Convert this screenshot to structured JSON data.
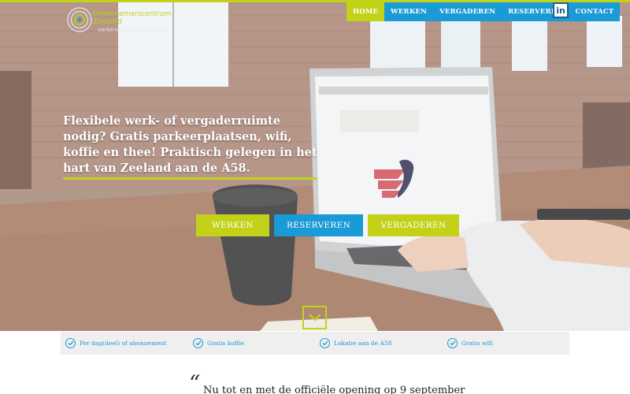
{
  "brand": {
    "name": "Ondernemerscentrum Zeeland",
    "tagline": "verbinden en verbinden",
    "accent": "#c3d219",
    "primary": "#1a9ad6"
  },
  "nav": {
    "items": [
      {
        "label": "HOME",
        "active": true
      },
      {
        "label": "WERKEN",
        "active": false
      },
      {
        "label": "VERGADEREN",
        "active": false
      },
      {
        "label": "RESERVEREN",
        "active": false
      },
      {
        "label": "CONTACT",
        "active": false
      }
    ],
    "social": {
      "icon": "linkedin-icon",
      "label": "in"
    }
  },
  "hero": {
    "headline": "Flexibele werk- of vergaderruimte nodig? Gratis parkeerplaatsen, wifi, koffie en thee! Praktisch gelegen in het hart van Zeeland aan de A58.",
    "buttons": [
      {
        "label": "WERKEN",
        "color": "#c3d219"
      },
      {
        "label": "RESERVEREN",
        "color": "#1a9ad6"
      },
      {
        "label": "VERGADEREN",
        "color": "#c3d219"
      }
    ],
    "scroll_icon": "chevron-down-icon"
  },
  "features": [
    {
      "label": "Per dag(deel) of abonnement",
      "icon": "check-circle-icon"
    },
    {
      "label": "Gratis koffie",
      "icon": "check-circle-icon"
    },
    {
      "label": "Lokatie aan de A58",
      "icon": "check-circle-icon"
    },
    {
      "label": "Gratis wifi",
      "icon": "check-circle-icon"
    }
  ],
  "quote": {
    "mark": "“",
    "text": "Nu tot en met de officiële opening op 9 september"
  }
}
